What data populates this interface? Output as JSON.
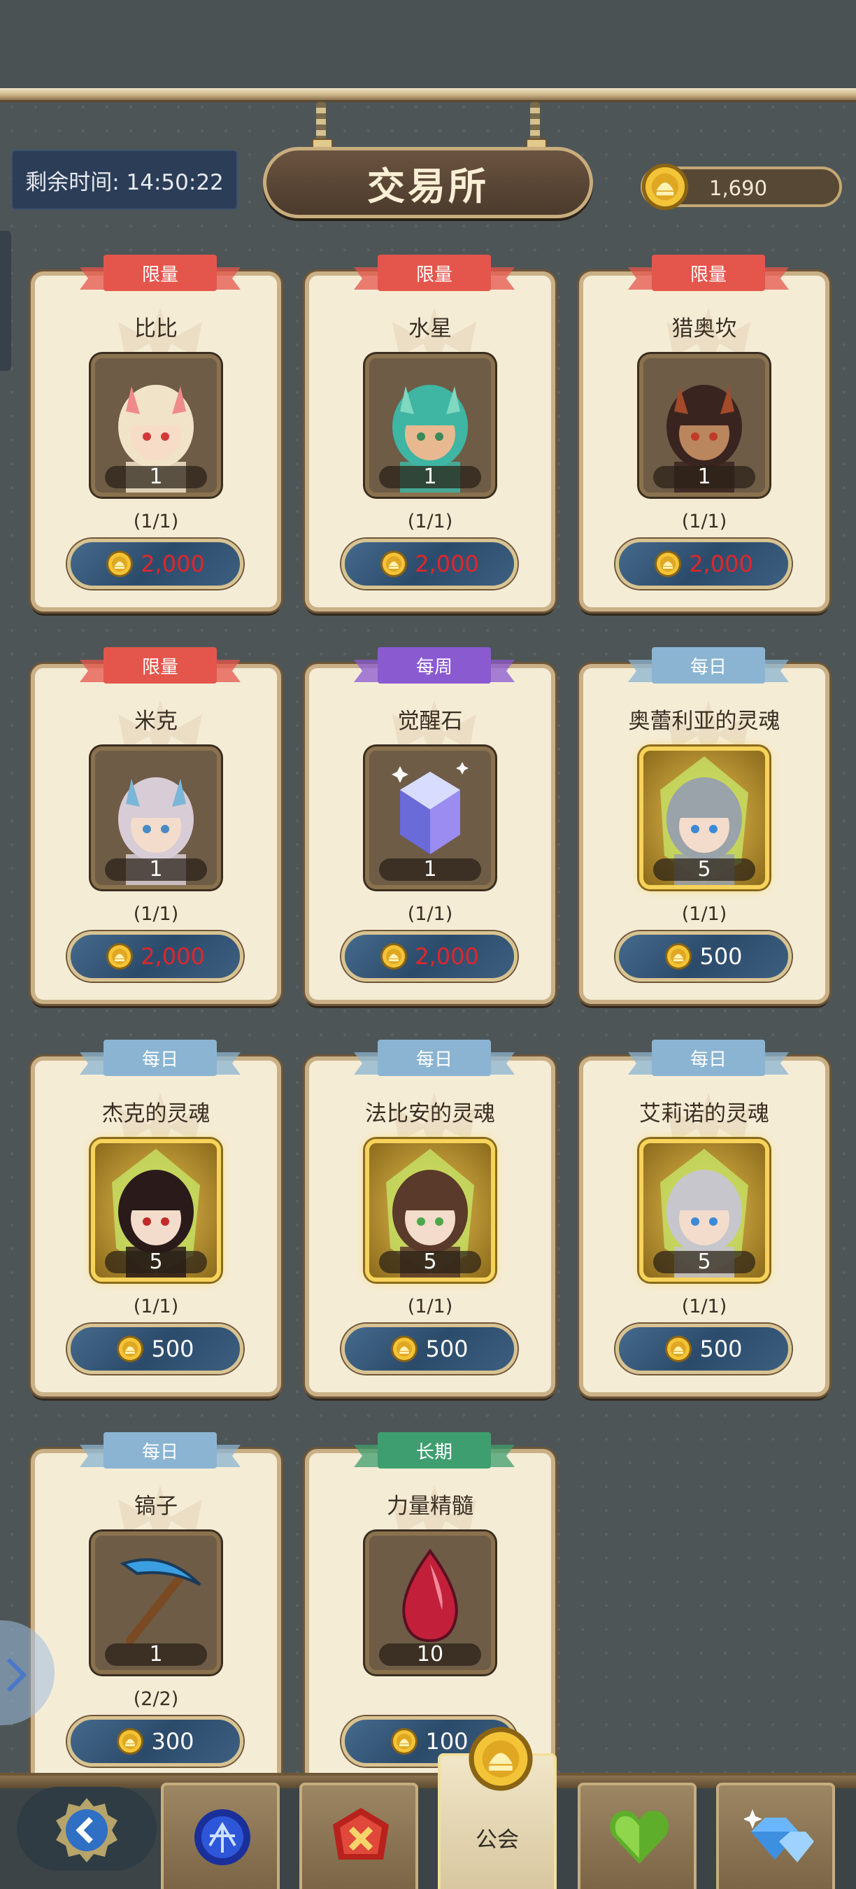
{
  "header": {
    "title": "交易所",
    "timer_label": "剩余时间: 14:50:22",
    "currency_amount": "1,690"
  },
  "colors": {
    "limited": "#e4564c",
    "weekly": "#8a5ad1",
    "daily": "#8ab4d2",
    "long_term": "#3f9e6f",
    "price_insufficient": "#e0262b"
  },
  "items": [
    {
      "tag": "限量",
      "name": "比比",
      "qty": "1",
      "limit": "(1/1)",
      "price": "2,000",
      "affordable": false
    },
    {
      "tag": "限量",
      "name": "水星",
      "qty": "1",
      "limit": "(1/1)",
      "price": "2,000",
      "affordable": false
    },
    {
      "tag": "限量",
      "name": "猎奥坎",
      "qty": "1",
      "limit": "(1/1)",
      "price": "2,000",
      "affordable": false
    },
    {
      "tag": "限量",
      "name": "米克",
      "qty": "1",
      "limit": "(1/1)",
      "price": "2,000",
      "affordable": false
    },
    {
      "tag": "每周",
      "name": "觉醒石",
      "qty": "1",
      "limit": "(1/1)",
      "price": "2,000",
      "affordable": false
    },
    {
      "tag": "每日",
      "name": "奥蕾利亚的灵魂",
      "qty": "5",
      "limit": "(1/1)",
      "price": "500",
      "affordable": true
    },
    {
      "tag": "每日",
      "name": "杰克的灵魂",
      "qty": "5",
      "limit": "(1/1)",
      "price": "500",
      "affordable": true
    },
    {
      "tag": "每日",
      "name": "法比安的灵魂",
      "qty": "5",
      "limit": "(1/1)",
      "price": "500",
      "affordable": true
    },
    {
      "tag": "每日",
      "name": "艾莉诺的灵魂",
      "qty": "5",
      "limit": "(1/1)",
      "price": "500",
      "affordable": true
    },
    {
      "tag": "每日",
      "name": "镐子",
      "qty": "1",
      "limit": "(2/2)",
      "price": "300",
      "affordable": true
    },
    {
      "tag": "长期",
      "name": "力量精髓",
      "qty": "10",
      "limit": "",
      "price": "100",
      "affordable": true
    }
  ],
  "bottom_nav": {
    "active_label": "公会",
    "tabs": [
      "back-icon",
      "blue-orb-icon",
      "red-cancel-icon",
      "guild-icon",
      "green-heart-icon",
      "diamond-icon"
    ]
  }
}
